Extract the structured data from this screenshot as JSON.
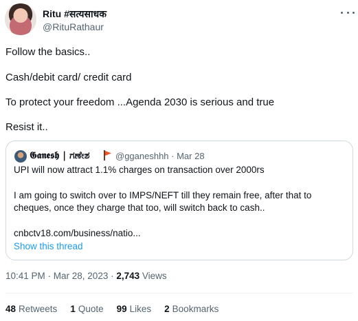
{
  "author": {
    "name": "Ritu #सत्यसाधक",
    "handle": "@RituRathaur"
  },
  "tweet": {
    "paragraphs": [
      "Follow the basics..",
      "Cash/debit card/ credit card",
      "To protect your freedom ...Agenda 2030 is serious and true",
      "Resist it.."
    ]
  },
  "quote": {
    "name": "𝕲𝖆𝖓𝖊𝖘𝖍 | ಗಣೇಶ",
    "handle_date": "@gganeshhh · Mar 28",
    "lines": [
      "UPI will now attract 1.1% charges on transaction over 2000rs",
      "I am going to switch over to IMPS/NEFT till they remain free, after that to",
      "cheques, once they charge that too, will switch back to cash..",
      "cnbctv18.com/business/natio..."
    ],
    "show_thread": "Show this thread"
  },
  "meta": {
    "time_date": "10:41 PM · Mar 28, 2023 · ",
    "views_count": "2,743",
    "views_label": " Views"
  },
  "stats": [
    {
      "count": "48",
      "label": "Retweets"
    },
    {
      "count": "1",
      "label": "Quote"
    },
    {
      "count": "99",
      "label": "Likes"
    },
    {
      "count": "2",
      "label": "Bookmarks"
    }
  ],
  "icons": {
    "more": "more-horizontal-icon",
    "flag": "flag-icon"
  },
  "colors": {
    "link": "#1d9bf0",
    "secondary_text": "#536471",
    "border": "#cfd9de"
  }
}
